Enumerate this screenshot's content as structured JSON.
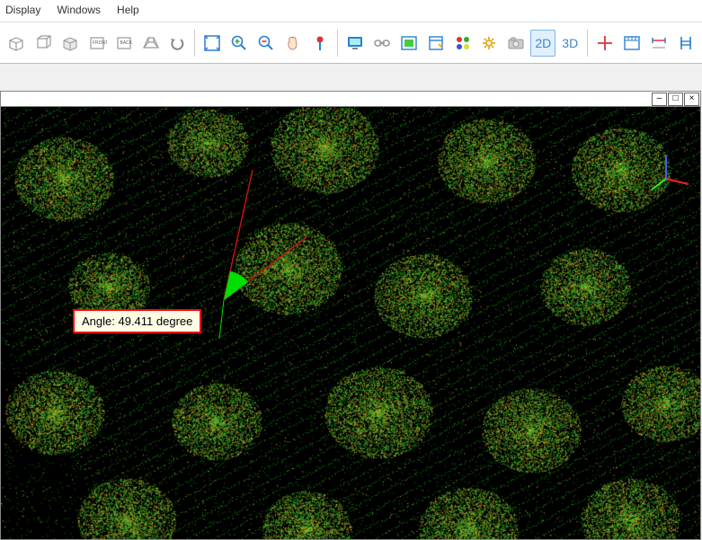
{
  "menu": {
    "display": "Display",
    "windows": "Windows",
    "help": "Help"
  },
  "toolbar": {
    "view2d": "2D",
    "view3d": "3D"
  },
  "measurement": {
    "label_prefix": "Angle: ",
    "value": "49.411",
    "unit": " degree"
  },
  "window_controls": {
    "minimize": "–",
    "maximize": "□",
    "close": "×"
  },
  "colors": {
    "axis_x": "#ff2020",
    "axis_y": "#20ff20",
    "axis_z": "#4060ff",
    "measure_line": "#d01010",
    "wedge": "#00dd00",
    "label_border": "#ff0000",
    "label_bg": "#fffde6"
  },
  "icons": {
    "iso": "iso-cube-icon",
    "front": "front-view-icon",
    "back": "back-view-icon",
    "persp": "perspective-icon",
    "undo": "undo-icon",
    "fit": "fit-view-icon",
    "zoom_in": "zoom-in-icon",
    "zoom_out": "zoom-out-icon",
    "pan": "pan-icon",
    "pin": "pin-icon",
    "screen": "screen-icon",
    "depth": "depth-icon",
    "layer": "layer-icon",
    "window": "window-icon",
    "colors": "color-swatch-icon",
    "gear": "settings-icon",
    "camera": "camera-icon",
    "crosshair": "crosshair-icon",
    "ruler1": "ruler-icon",
    "ruler2": "dimension-icon",
    "calipers": "calipers-icon"
  }
}
